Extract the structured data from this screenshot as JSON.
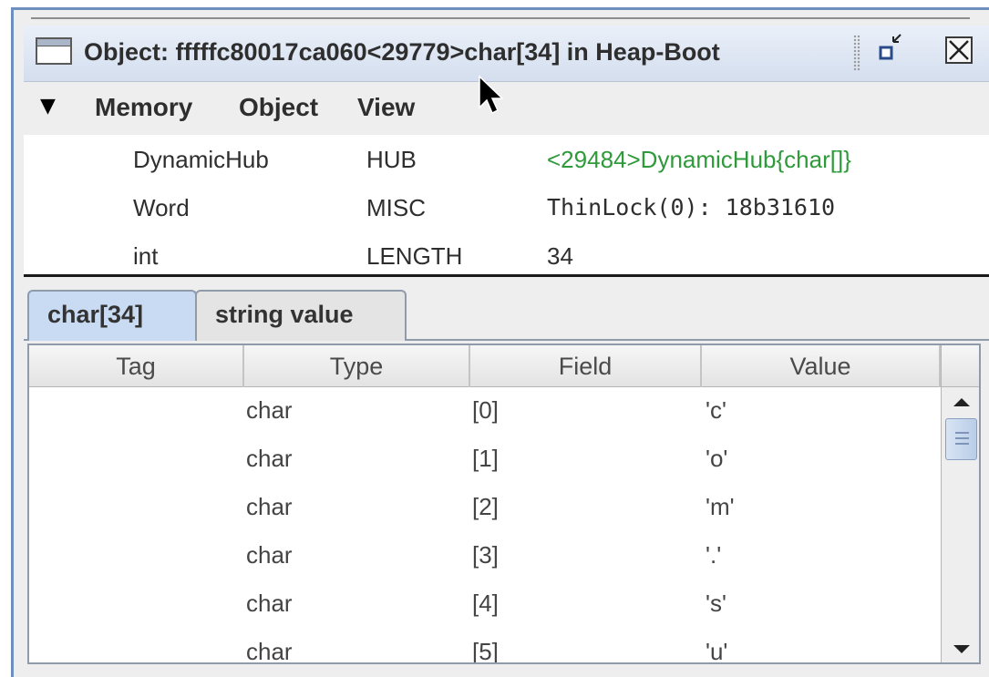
{
  "window": {
    "title": "Object: fffffc80017ca060<29779>char[34] in Heap-Boot"
  },
  "menu": {
    "items": [
      "Memory",
      "Object",
      "View"
    ]
  },
  "header_fields": [
    {
      "type": "DynamicHub",
      "field": "HUB",
      "value": "<29484>DynamicHub{char[]}",
      "value_style": "link"
    },
    {
      "type": "Word",
      "field": "MISC",
      "value": "ThinLock(0): 18b31610",
      "value_style": "mono"
    },
    {
      "type": "int",
      "field": "LENGTH",
      "value": "34",
      "value_style": "plain"
    }
  ],
  "tabs": [
    {
      "label": "char[34]",
      "active": true
    },
    {
      "label": "string value",
      "active": false
    }
  ],
  "table": {
    "columns": [
      "Tag",
      "Type",
      "Field",
      "Value"
    ],
    "rows": [
      {
        "tag": "",
        "type": "char",
        "field": "[0]",
        "value": "'c'"
      },
      {
        "tag": "",
        "type": "char",
        "field": "[1]",
        "value": "'o'"
      },
      {
        "tag": "",
        "type": "char",
        "field": "[2]",
        "value": "'m'"
      },
      {
        "tag": "",
        "type": "char",
        "field": "[3]",
        "value": "'.'"
      },
      {
        "tag": "",
        "type": "char",
        "field": "[4]",
        "value": "'s'"
      },
      {
        "tag": "",
        "type": "char",
        "field": "[5]",
        "value": "'u'"
      }
    ]
  },
  "colors": {
    "link_green": "#2e9a3a",
    "tab_active": "#c9dbf2",
    "title_bar": "#d4deee"
  },
  "icons": {
    "window": "window-icon",
    "restore": "restore-icon",
    "close": "close-icon",
    "menu_arrow": "triangle-down-icon",
    "cursor": "mouse-cursor-icon"
  }
}
